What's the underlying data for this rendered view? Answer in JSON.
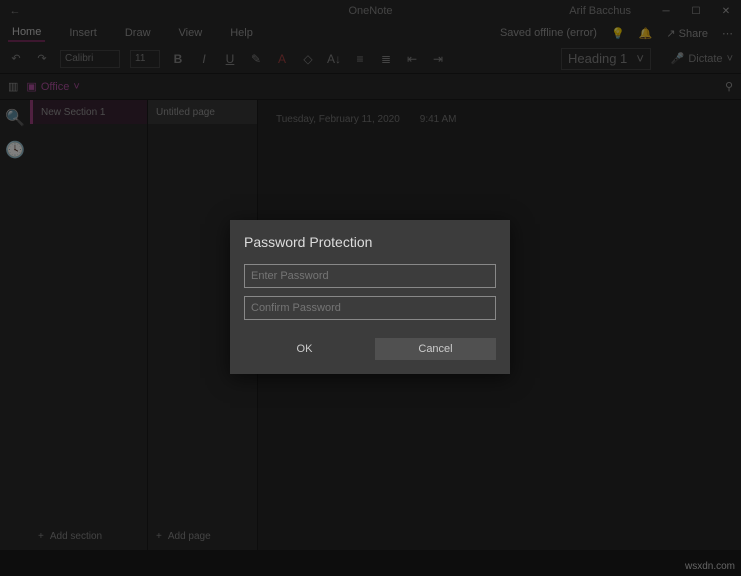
{
  "titlebar": {
    "app": "OneNote",
    "user": "Arif Bacchus"
  },
  "menu": {
    "tabs": [
      "Home",
      "Insert",
      "Draw",
      "View",
      "Help"
    ],
    "active": 0,
    "status": "Saved offline (error)",
    "share": "Share"
  },
  "toolbar": {
    "font": "Calibri",
    "size": "11",
    "heading": "Heading 1",
    "dictate": "Dictate"
  },
  "nav": {
    "notebook": "Office"
  },
  "sections": {
    "items": [
      "New Section 1"
    ],
    "add": "Add section"
  },
  "pages": {
    "items": [
      "Untitled page"
    ],
    "add": "Add page"
  },
  "canvas": {
    "date": "Tuesday, February 11, 2020",
    "time": "9:41 AM"
  },
  "dialog": {
    "title": "Password Protection",
    "enter_ph": "Enter Password",
    "confirm_ph": "Confirm Password",
    "ok": "OK",
    "cancel": "Cancel"
  },
  "watermark": "wsxdn.com"
}
